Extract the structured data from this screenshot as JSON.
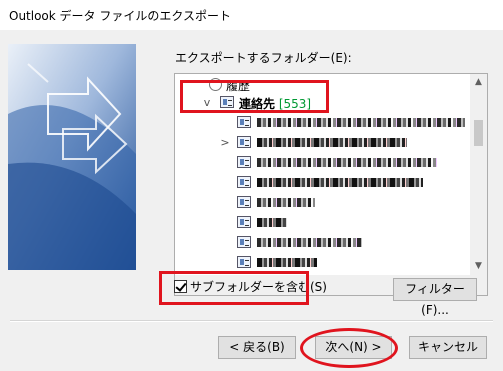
{
  "window": {
    "title": "Outlook データ ファイルのエクスポート"
  },
  "folder_label": "エクスポートするフォルダー(E):",
  "tree": {
    "history_label": "履歴",
    "contacts_label": "連絡先",
    "contacts_count": "[553]"
  },
  "checkbox": {
    "label": "サブフォルダーを含む(S)",
    "checked": true
  },
  "buttons": {
    "filter": "フィルター(F)...",
    "back": "< 戻る(B)",
    "next": "次へ(N) >",
    "cancel": "キャンセル"
  },
  "annotation_color": "#e0141e",
  "count_color": "#009933"
}
